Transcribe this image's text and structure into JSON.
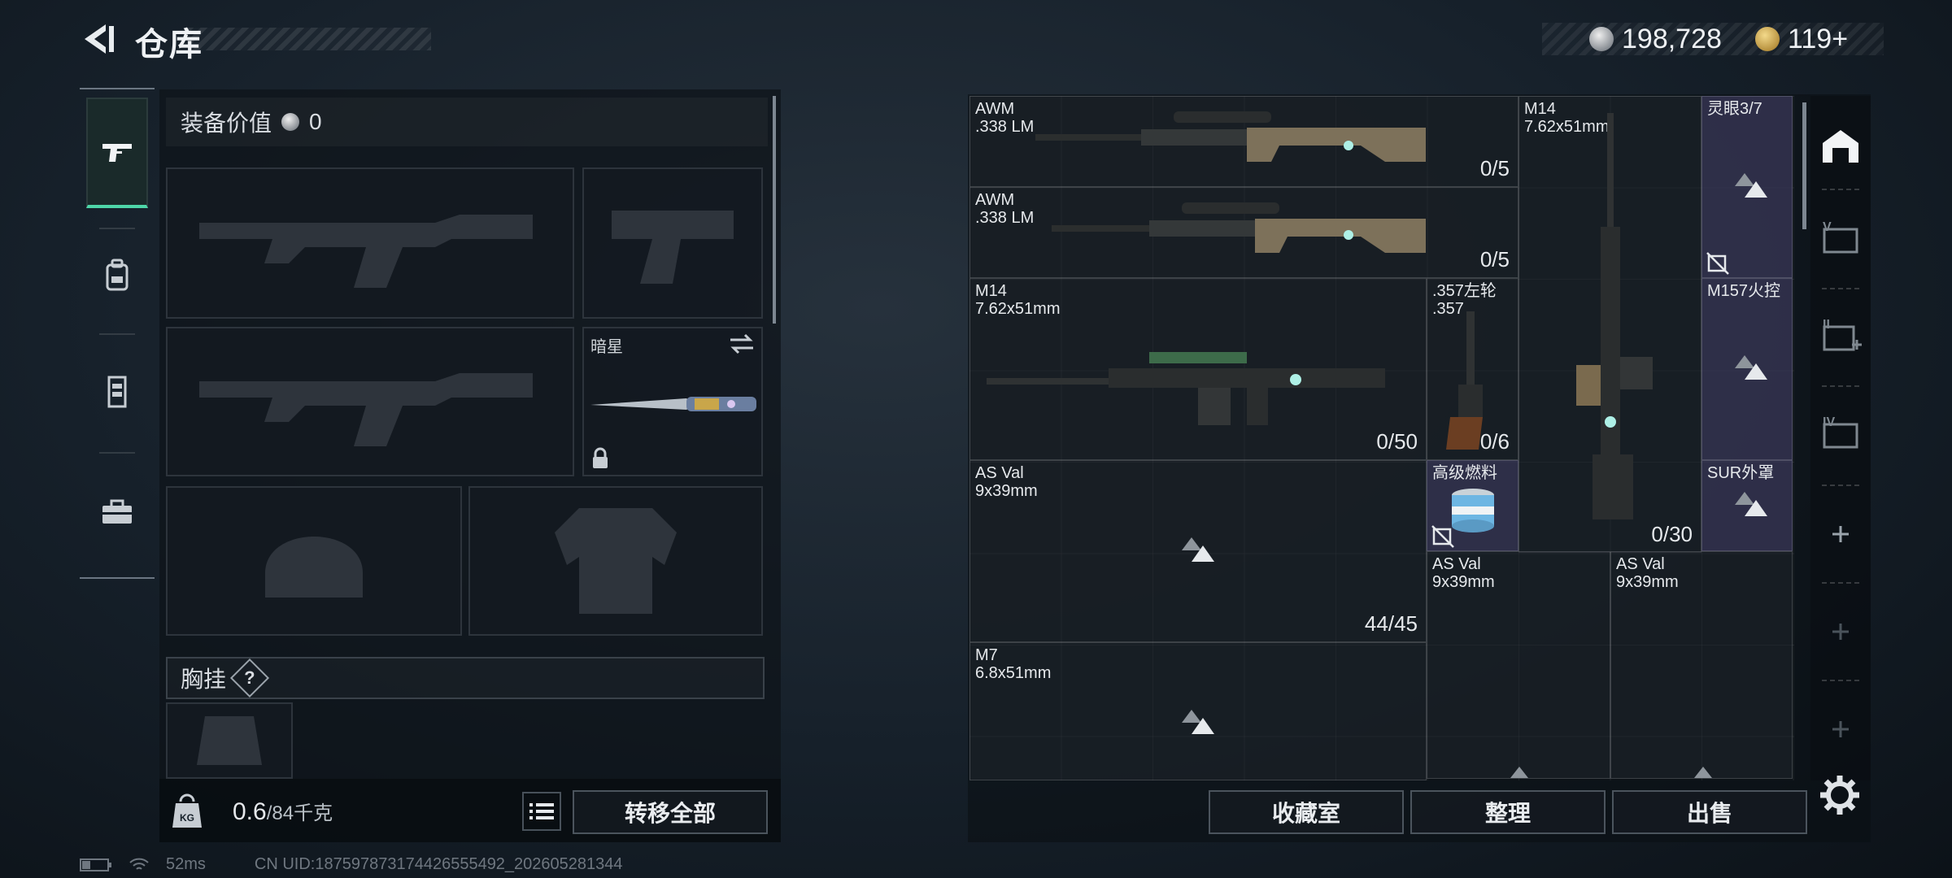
{
  "header": {
    "title": "仓库"
  },
  "currency": {
    "silver": "198,728",
    "gold": "119+"
  },
  "nav": [
    "weapons-icon",
    "backpack-icon",
    "armor-vest-icon",
    "toolbox-icon"
  ],
  "loadout": {
    "value_label": "装备价值",
    "value": "0",
    "melee_label": "暗星",
    "chest_label": "胸挂",
    "help": "?",
    "weight_current": "0.6",
    "weight_max": "/84千克",
    "transfer_all": "转移全部"
  },
  "storage": {
    "items": [
      {
        "name": "AWM\n.338 LM",
        "count": "0/5"
      },
      {
        "name": "AWM\n.338 LM",
        "count": "0/5"
      },
      {
        "name": "M14\n7.62x51mm",
        "count": "0/50"
      },
      {
        "name": ".357左轮\n.357",
        "count": "0/6"
      },
      {
        "name": "M14\n7.62x51mm",
        "count": "0/30"
      },
      {
        "name": "灵眼3/7",
        "count": ""
      },
      {
        "name": "M157火控",
        "count": ""
      },
      {
        "name": "SUR外罩",
        "count": ""
      },
      {
        "name": "高级燃料",
        "count": ""
      },
      {
        "name": "AS Val\n9x39mm",
        "count": "44/45"
      },
      {
        "name": "AS Val\n9x39mm",
        "count": ""
      },
      {
        "name": "AS Val\n9x39mm",
        "count": ""
      },
      {
        "name": "M7\n6.8x51mm",
        "count": ""
      }
    ]
  },
  "actions": {
    "collection": "收藏室",
    "organize": "整理",
    "sell": "出售"
  },
  "status": {
    "ping": "52ms",
    "uid": "CN UID:187597873174426555492_202605281344"
  }
}
